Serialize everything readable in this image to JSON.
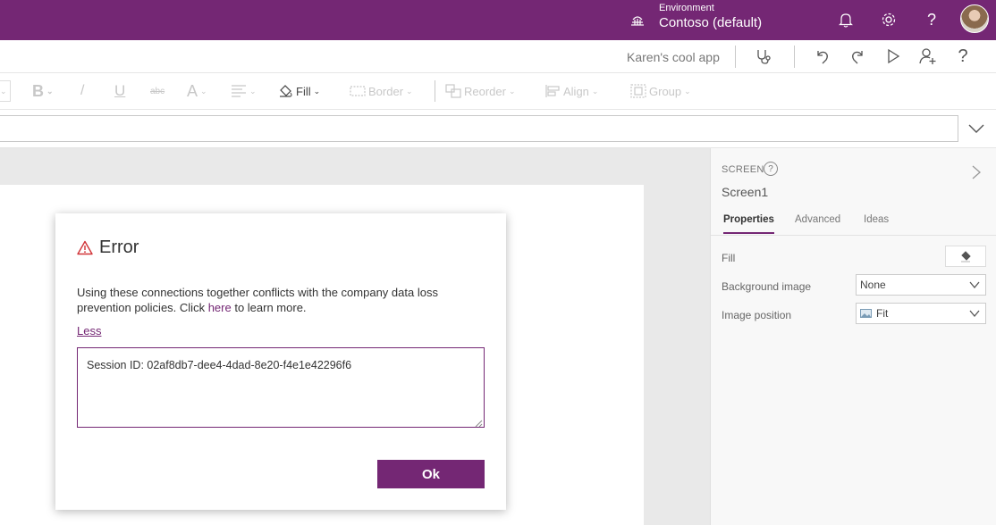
{
  "topbar": {
    "environment_label": "Environment",
    "environment_name": "Contoso (default)",
    "icons": [
      "environment-icon",
      "bell-icon",
      "gear-icon",
      "help-icon",
      "avatar"
    ],
    "help_glyph": "?"
  },
  "command_bar": {
    "app_name": "Karen's cool app",
    "help_glyph": "?",
    "icons": [
      "app-checker-icon",
      "undo-icon",
      "redo-icon",
      "play-icon",
      "share-icon",
      "help-icon"
    ]
  },
  "format_toolbar": {
    "bold": "B",
    "italic": "/",
    "underline": "U",
    "strike": "abc",
    "font_size": "A",
    "fill": "Fill",
    "border": "Border",
    "reorder": "Reorder",
    "align": "Align",
    "group": "Group"
  },
  "right_pane": {
    "type_label": "SCREEN",
    "help_glyph": "?",
    "screen_name": "Screen1",
    "tabs": [
      {
        "label": "Properties"
      },
      {
        "label": "Advanced"
      },
      {
        "label": "Ideas"
      }
    ],
    "fill_label": "Fill",
    "background_image_label": "Background image",
    "background_image_value": "None",
    "image_position_label": "Image position",
    "image_position_value": "Fit"
  },
  "dialog": {
    "title": "Error",
    "message_before_link": "Using these connections together conflicts with the company data loss prevention policies. Click ",
    "link_text": "here",
    "message_after_link": " to learn more.",
    "less_label": "Less",
    "details": "Session ID: 02af8db7-dee4-4dad-8e20-f4e1e42296f6",
    "ok_label": "Ok"
  },
  "colors": {
    "brand_purple": "#742774",
    "warning_red": "#d13438"
  }
}
